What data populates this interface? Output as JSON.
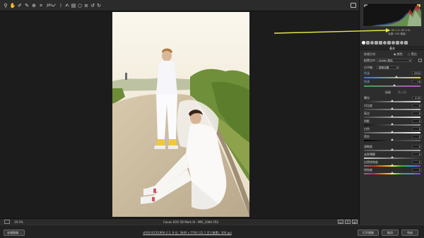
{
  "toolbar": {
    "zoom_pct": "50%",
    "tools": [
      {
        "name": "zoom-tool-icon",
        "glyph": "⚲"
      },
      {
        "name": "hand-tool-icon",
        "glyph": "✋"
      },
      {
        "name": "white-balance-tool-icon",
        "glyph": "✐"
      },
      {
        "name": "color-sampler-tool-icon",
        "glyph": "✎"
      },
      {
        "name": "targeted-adjust-tool-icon",
        "glyph": "⊕"
      },
      {
        "name": "crop-tool-icon",
        "glyph": "⌗"
      },
      {
        "name": "straighten-tool-icon",
        "glyph": "⟋"
      },
      {
        "name": "spot-removal-tool-icon",
        "glyph": "✓"
      },
      {
        "name": "red-eye-tool-icon",
        "glyph": "⁞"
      },
      {
        "name": "adjustment-brush-icon",
        "glyph": "✍"
      },
      {
        "name": "graduated-filter-icon",
        "glyph": "▤"
      },
      {
        "name": "radial-filter-icon",
        "glyph": "○"
      },
      {
        "name": "preferences-icon",
        "glyph": "≡"
      },
      {
        "name": "rotate-ccw-icon",
        "glyph": "↺"
      },
      {
        "name": "rotate-cw-icon",
        "glyph": "↻"
      }
    ]
  },
  "histogram": {
    "rgb": "R: 65.0  G: 60.5  B:",
    "rgb2": "光圈: 200  焦距:"
  },
  "panel": {
    "header": "基本",
    "rows": {
      "process_label": "处理方式:",
      "process_color": "颜色",
      "process_bw": "黑白",
      "profile_label": "配置文件:",
      "profile_value": "Adobe 颜色",
      "wb_label": "白平衡:",
      "wb_value": "原照设置",
      "temp_label": "色温",
      "temp_value": "5950",
      "tint_label": "色调",
      "tint_value": "+6",
      "auto_label": "自动",
      "default_label": "默认值",
      "exposure_label": "曝光",
      "exposure_value": "0.00",
      "contrast_label": "对比度",
      "contrast_value": "0",
      "highlights_label": "高光",
      "highlights_value": "0",
      "shadows_label": "阴影",
      "shadows_value": "0",
      "whites_label": "白色",
      "whites_value": "0",
      "blacks_label": "黑色",
      "blacks_value": "0",
      "clarity_label": "清晰度",
      "clarity_value": "0",
      "dehaze_label": "去除薄雾",
      "dehaze_value": "0",
      "vibrance_label": "自然饱和度",
      "vibrance_value": "0",
      "saturation_label": "饱和度",
      "saturation_value": "0"
    }
  },
  "statusbar": {
    "zoom": "19.5%",
    "filename": "Canon EOS 5D Mark III - IMG_1084.CR2"
  },
  "bottombar": {
    "save_label": "存储图像...",
    "workflow": "sRGB IEC61966-2.1; 8 位; 3840 x 5760 (22.1 百万像素); 300 ppi",
    "open_label": "打开图像",
    "cancel_label": "取消",
    "done_label": "完成"
  },
  "colors": {
    "arrow": "#e6e84a",
    "accent": "#4aa0e6"
  }
}
